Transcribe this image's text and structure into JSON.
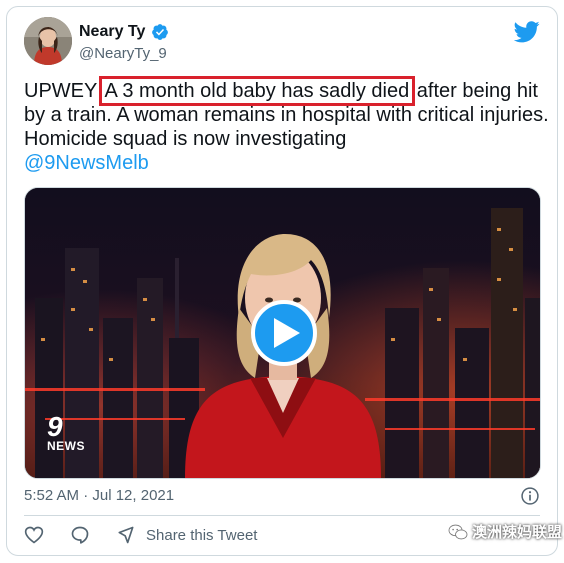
{
  "tweet": {
    "display_name": "Neary Ty",
    "handle": "@NearyTy_9",
    "text_parts": {
      "before": "UPWEY ",
      "highlight": "A 3 month old baby has sadly died",
      "after": " after being hit by a train. A woman remains in hospital with critical injuries. Homicide squad is now investigating",
      "mention": "@9NewsMelb"
    },
    "timestamp": "5:52 AM · Jul 12, 2021"
  },
  "media": {
    "logo_number": "9",
    "logo_text": "NEWS"
  },
  "actions": {
    "share_label": "Share this Tweet"
  },
  "watermark": {
    "text": "澳洲辣妈联盟"
  },
  "colors": {
    "accent": "#1d9bf0",
    "highlight_box": "#d9212c",
    "text": "#0f1419",
    "muted": "#536471"
  },
  "icons": [
    "verified-badge-icon",
    "twitter-bird-icon",
    "play-icon",
    "info-icon",
    "heart-icon",
    "reply-icon",
    "share-icon",
    "wechat-icon"
  ]
}
